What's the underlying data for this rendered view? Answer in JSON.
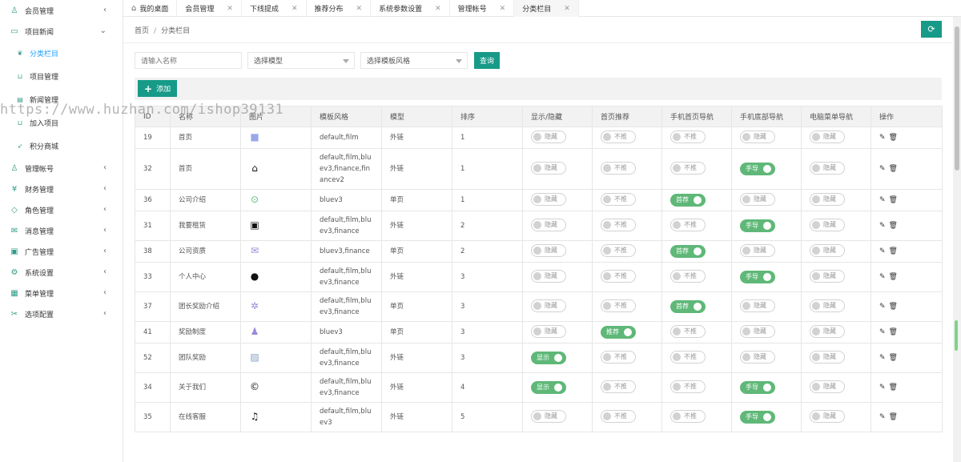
{
  "sidebar": {
    "items": [
      {
        "icon": "user-icon",
        "label": "会员管理",
        "expanded": false
      },
      {
        "icon": "book-icon",
        "label": "项目新闻",
        "expanded": true,
        "children": [
          {
            "icon": "leaf-icon",
            "label": "分类栏目",
            "active": true
          },
          {
            "icon": "cart-icon",
            "label": "项目管理"
          },
          {
            "icon": "news-icon",
            "label": "新闻管理"
          },
          {
            "icon": "cart-icon",
            "label": "加入项目"
          },
          {
            "icon": "send-icon",
            "label": "积分商城"
          }
        ]
      },
      {
        "icon": "user-group-icon",
        "label": "管理帐号"
      },
      {
        "icon": "money-icon",
        "label": "财务管理"
      },
      {
        "icon": "shield-icon",
        "label": "角色管理"
      },
      {
        "icon": "message-icon",
        "label": "消息管理"
      },
      {
        "icon": "ad-icon",
        "label": "广告管理"
      },
      {
        "icon": "gear-icon",
        "label": "系统设置"
      },
      {
        "icon": "menu-icon",
        "label": "菜单管理"
      },
      {
        "icon": "options-icon",
        "label": "选项配置"
      }
    ]
  },
  "tabs": [
    {
      "label": "我的桌面",
      "home": true
    },
    {
      "label": "会员管理"
    },
    {
      "label": "下线提成"
    },
    {
      "label": "推荐分布"
    },
    {
      "label": "系统参数设置"
    },
    {
      "label": "管理帐号"
    },
    {
      "label": "分类栏目",
      "active": true
    }
  ],
  "breadcrumb": {
    "home": "首页",
    "current": "分类栏目"
  },
  "filters": {
    "name_placeholder": "请输入名称",
    "model_select": "选择模型",
    "style_select": "选择模板风格",
    "search_button": "查询"
  },
  "toolbar": {
    "add_button": "添加"
  },
  "table": {
    "headers": [
      "ID",
      "名称",
      "图片",
      "模板风格",
      "模型",
      "排序",
      "显示/隐藏",
      "首页推荐",
      "手机首页导航",
      "手机底部导航",
      "电脑菜单导航",
      "操作"
    ],
    "rows": [
      {
        "id": "19",
        "name": "首页",
        "icon": "square-icon",
        "style": "default,film",
        "model": "外链",
        "sort": "1",
        "show": "隐藏",
        "rec": "不推",
        "mhome": "不推",
        "mbottom": "隐藏",
        "pc": "隐藏",
        "show_on": false,
        "rec_on": false,
        "mhome_on": false,
        "mbottom_on": false
      },
      {
        "id": "32",
        "name": "首页",
        "icon": "home-icon",
        "style": "default,film,bluev3,finance,financev2",
        "model": "外链",
        "sort": "1",
        "show": "隐藏",
        "rec": "不推",
        "mhome": "不推",
        "mbottom": "手导",
        "pc": "隐藏",
        "show_on": false,
        "rec_on": false,
        "mhome_on": false,
        "mbottom_on": true
      },
      {
        "id": "36",
        "name": "公司介绍",
        "icon": "search-person-icon",
        "style": "bluev3",
        "model": "单页",
        "sort": "1",
        "show": "隐藏",
        "rec": "不推",
        "mhome": "首荐",
        "mbottom": "隐藏",
        "pc": "隐藏",
        "show_on": false,
        "rec_on": false,
        "mhome_on": true,
        "mbottom_on": false
      },
      {
        "id": "31",
        "name": "我要租赁",
        "icon": "box-icon",
        "style": "default,film,bluev3,finance",
        "model": "外链",
        "sort": "2",
        "show": "隐藏",
        "rec": "不推",
        "mhome": "不推",
        "mbottom": "手导",
        "pc": "隐藏",
        "show_on": false,
        "rec_on": false,
        "mhome_on": false,
        "mbottom_on": true
      },
      {
        "id": "38",
        "name": "公司资质",
        "icon": "envelope-icon",
        "style": "bluev3,finance",
        "model": "单页",
        "sort": "2",
        "show": "隐藏",
        "rec": "不推",
        "mhome": "首荐",
        "mbottom": "隐藏",
        "pc": "隐藏",
        "show_on": false,
        "rec_on": false,
        "mhome_on": true,
        "mbottom_on": false
      },
      {
        "id": "33",
        "name": "个人中心",
        "icon": "person-icon",
        "style": "default,film,bluev3,finance",
        "model": "外链",
        "sort": "3",
        "show": "隐藏",
        "rec": "不推",
        "mhome": "不推",
        "mbottom": "手导",
        "pc": "隐藏",
        "show_on": false,
        "rec_on": false,
        "mhome_on": false,
        "mbottom_on": true
      },
      {
        "id": "37",
        "name": "团长奖励介绍",
        "icon": "team-icon",
        "style": "default,film,bluev3,finance",
        "model": "单页",
        "sort": "3",
        "show": "隐藏",
        "rec": "不推",
        "mhome": "首荐",
        "mbottom": "隐藏",
        "pc": "隐藏",
        "show_on": false,
        "rec_on": false,
        "mhome_on": true,
        "mbottom_on": false
      },
      {
        "id": "41",
        "name": "奖励制度",
        "icon": "group-icon",
        "style": "bluev3",
        "model": "单页",
        "sort": "3",
        "show": "隐藏",
        "rec": "推荐",
        "mhome": "不推",
        "mbottom": "隐藏",
        "pc": "隐藏",
        "show_on": false,
        "rec_on": true,
        "mhome_on": false,
        "mbottom_on": false
      },
      {
        "id": "52",
        "name": "团队奖励",
        "icon": "broken-image-icon",
        "style": "default,film,bluev3,finance",
        "model": "外链",
        "sort": "3",
        "show": "显示",
        "rec": "不推",
        "mhome": "不推",
        "mbottom": "隐藏",
        "pc": "隐藏",
        "show_on": true,
        "rec_on": false,
        "mhome_on": false,
        "mbottom_on": false
      },
      {
        "id": "34",
        "name": "关于我们",
        "icon": "copyright-icon",
        "style": "default,film,bluev3,finance",
        "model": "外链",
        "sort": "4",
        "show": "显示",
        "rec": "不推",
        "mhome": "不推",
        "mbottom": "手导",
        "pc": "隐藏",
        "show_on": true,
        "rec_on": false,
        "mhome_on": false,
        "mbottom_on": true
      },
      {
        "id": "35",
        "name": "在线客服",
        "icon": "headset-icon",
        "style": "default,film,bluev3",
        "model": "外链",
        "sort": "5",
        "show": "隐藏",
        "rec": "不推",
        "mhome": "不推",
        "mbottom": "手导",
        "pc": "隐藏",
        "show_on": false,
        "rec_on": false,
        "mhome_on": false,
        "mbottom_on": true
      }
    ]
  },
  "watermark": "https://www.huzhan.com/ishop39131",
  "colors": {
    "accent": "#179a88",
    "switch_on": "#5fb878",
    "active_link": "#1e9fff"
  }
}
